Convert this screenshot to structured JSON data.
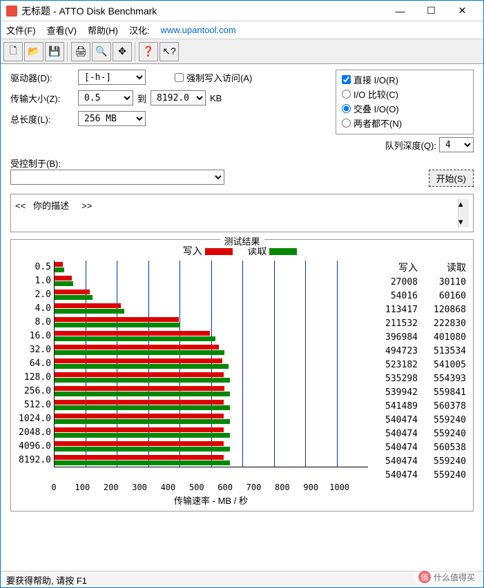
{
  "window": {
    "title": "无标题 - ATTO Disk Benchmark"
  },
  "menu": {
    "file": "文件(F)",
    "view": "查看(V)",
    "help": "帮助(H)",
    "localize": "汉化:",
    "url": "www.upantool.com"
  },
  "toolbar_icons": {
    "new": "🗋",
    "open": "📂",
    "save": "💾",
    "print": "🖨",
    "preview": "🔍",
    "move": "✥",
    "qmark": "❓",
    "arrowq": "↖?"
  },
  "labels": {
    "drive": "驱动器(D):",
    "transfer": "传输大小(Z):",
    "to": "到",
    "kb": "KB",
    "length": "总长度(L):",
    "force": "强制写入访问(A)",
    "direct": "直接 I/O(R)",
    "io_cmp": "I/O 比较(C)",
    "overlap": "交叠 I/O(O)",
    "neither": "两者都不(N)",
    "qdepth": "队列深度(Q):",
    "controlled": "受控制于(B):",
    "start": "开始(S)",
    "desc_open": "<<",
    "desc_text": "你的描述",
    "desc_close": ">>",
    "results": "测试结果",
    "write": "写入",
    "read": "读取",
    "xlabel": "传输速率 - MB / 秒",
    "status": "要获得帮助, 请按 F1",
    "watermark": "什么值得买",
    "wm_badge": "值"
  },
  "values": {
    "drive": "[-h-]",
    "size_from": "0.5",
    "size_to": "8192.0",
    "length": "256 MB",
    "qdepth": "4",
    "force": false,
    "direct": true,
    "io_mode": "overlap"
  },
  "chart_data": {
    "type": "bar",
    "x_max": 1000,
    "x_ticks": [
      "0",
      "100",
      "200",
      "300",
      "400",
      "500",
      "600",
      "700",
      "800",
      "900",
      "1000"
    ],
    "categories": [
      "0.5",
      "1.0",
      "2.0",
      "4.0",
      "8.0",
      "16.0",
      "32.0",
      "64.0",
      "128.0",
      "256.0",
      "512.0",
      "1024.0",
      "2048.0",
      "4096.0",
      "8192.0"
    ],
    "series": [
      {
        "name": "写入",
        "color": "#d00",
        "values": [
          27008,
          54016,
          113417,
          211532,
          396984,
          494723,
          523182,
          535298,
          539942,
          541489,
          540474,
          540474,
          540474,
          540474,
          540474
        ]
      },
      {
        "name": "读取",
        "color": "#080",
        "values": [
          30110,
          60160,
          120868,
          222830,
          401080,
          513534,
          541005,
          554393,
          559841,
          560378,
          559240,
          559240,
          560538,
          559240,
          559240
        ]
      }
    ],
    "bar_scale_factor": 1000,
    "title": "测试结果",
    "xlabel": "传输速率 - MB / 秒",
    "ylabel": ""
  }
}
